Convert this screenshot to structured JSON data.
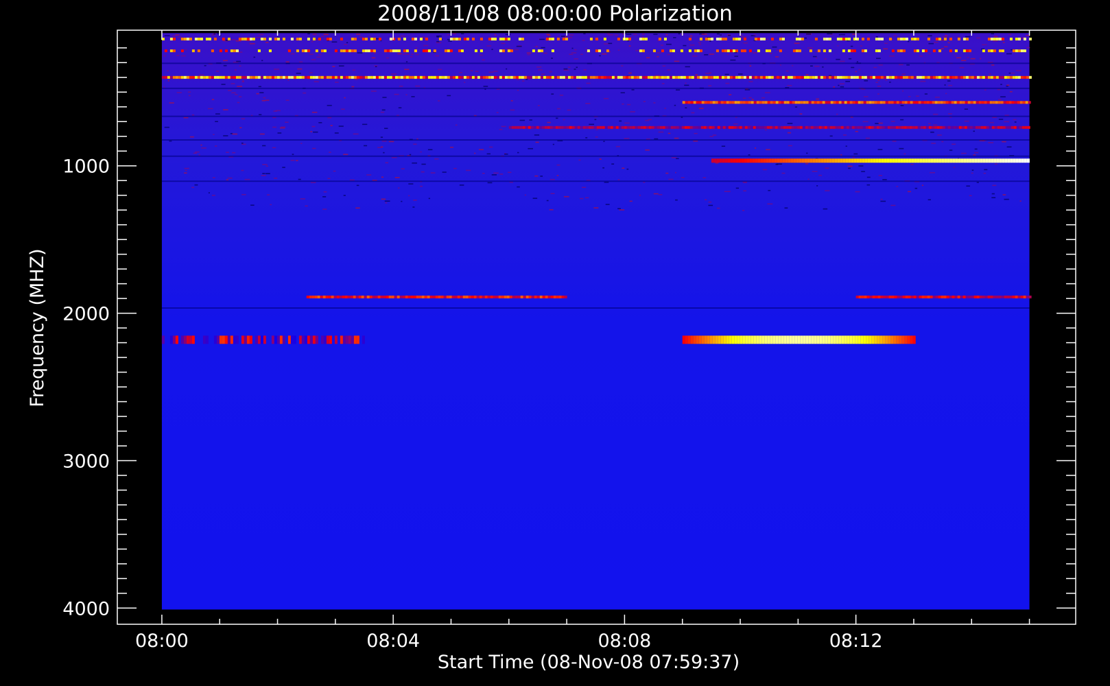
{
  "chart_data": {
    "type": "heatmap",
    "title": "2008/11/08 08:00:00 Polarization",
    "xlabel": "Start Time (08-Nov-08 07:59:37)",
    "ylabel": "Frequency (MHZ)",
    "x_unit": "minutes after 08:00",
    "xlim": [
      -0.77,
      15.8
    ],
    "x_data_range": [
      0,
      15.0
    ],
    "ylim": [
      4110,
      80
    ],
    "y_data_range": [
      100,
      4010
    ],
    "y_inverted": true,
    "x_ticks": [
      {
        "value": 0,
        "label": "08:00"
      },
      {
        "value": 4,
        "label": "08:04"
      },
      {
        "value": 8,
        "label": "08:08"
      },
      {
        "value": 12,
        "label": "08:12"
      }
    ],
    "y_ticks": [
      {
        "value": 1000,
        "label": "1000"
      },
      {
        "value": 2000,
        "label": "2000"
      },
      {
        "value": 3000,
        "label": "3000"
      },
      {
        "value": 4000,
        "label": "4000"
      }
    ],
    "colormap": [
      "#000000",
      "#0000ff",
      "#ff0000",
      "#ffff00",
      "#ffffff"
    ],
    "background_color": "#1212ee",
    "bands": [
      {
        "freq": 140,
        "x_start": 0.0,
        "x_end": 15.0,
        "intensity": 0.85,
        "pattern": "dashed"
      },
      {
        "freq": 220,
        "x_start": 0.0,
        "x_end": 15.0,
        "intensity": 0.8,
        "pattern": "dashed"
      },
      {
        "freq": 400,
        "x_start": 0.0,
        "x_end": 15.0,
        "intensity": 0.8,
        "pattern": "dotted"
      },
      {
        "freq": 570,
        "x_start": 9.0,
        "x_end": 15.0,
        "intensity": 0.6,
        "pattern": "solid"
      },
      {
        "freq": 740,
        "x_start": 6.0,
        "x_end": 15.0,
        "intensity": 0.45,
        "pattern": "solid"
      },
      {
        "freq": 965,
        "x_start": 9.5,
        "x_end": 15.0,
        "intensity": 0.9,
        "pattern": "ramp"
      },
      {
        "freq": 1890,
        "x_start": 2.5,
        "x_end": 7.0,
        "intensity": 0.55,
        "pattern": "solid"
      },
      {
        "freq": 1890,
        "x_start": 12.0,
        "x_end": 15.0,
        "intensity": 0.5,
        "pattern": "solid"
      },
      {
        "freq": 2180,
        "x_start": 0.0,
        "x_end": 3.5,
        "intensity": 0.5,
        "pattern": "speckle"
      },
      {
        "freq": 2180,
        "x_start": 9.0,
        "x_end": 13.0,
        "intensity": 0.85,
        "pattern": "peak"
      }
    ],
    "grid": false
  }
}
